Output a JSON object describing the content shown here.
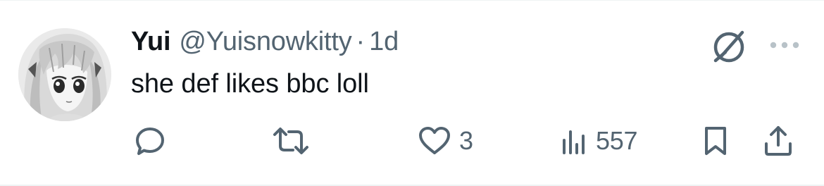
{
  "tweet": {
    "display_name": "Yui",
    "handle": "@Yuisnowkitty",
    "separator": "·",
    "time": "1d",
    "text": "she def likes bbc loll"
  },
  "actions": {
    "replies_count": "",
    "retweets_count": "",
    "likes_count": "3",
    "views_count": "557"
  },
  "icons": {
    "avatar": "anime-avatar",
    "grok": "grok-icon",
    "more": "more-icon",
    "reply": "reply-icon",
    "retweet": "retweet-icon",
    "like": "heart-icon",
    "views": "views-icon",
    "bookmark": "bookmark-icon",
    "share": "share-icon"
  },
  "colors": {
    "text_primary": "#0f1419",
    "text_secondary": "#536471",
    "divider": "#eff3f4"
  }
}
